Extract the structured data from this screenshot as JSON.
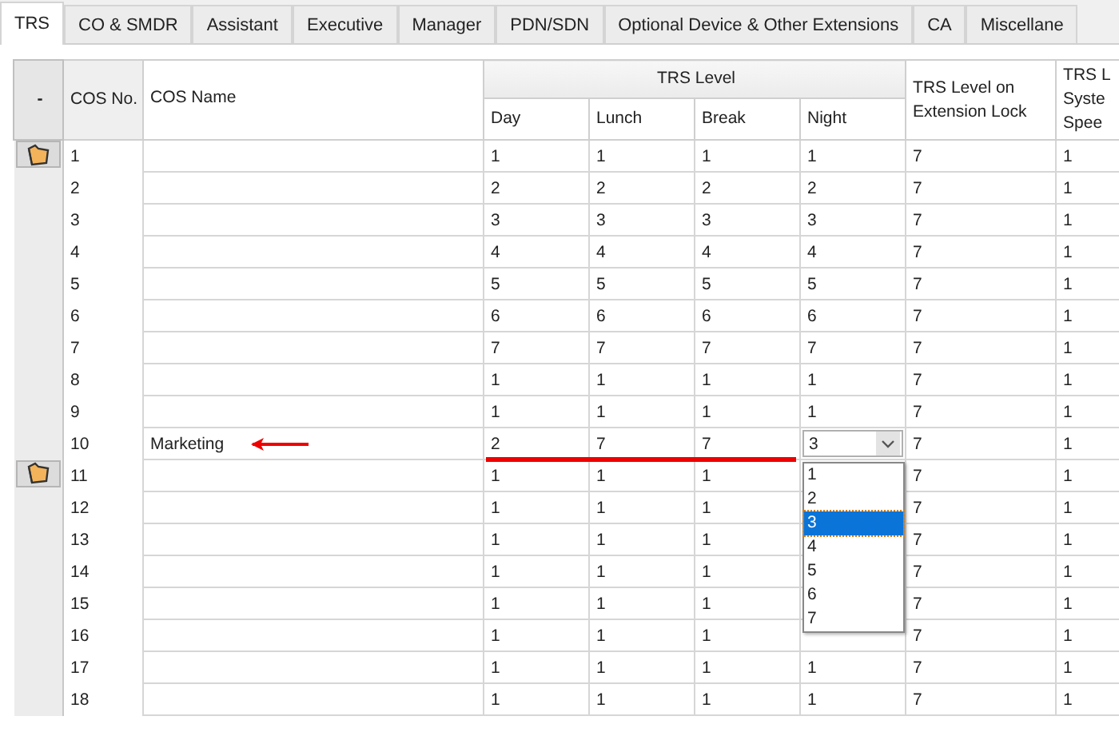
{
  "tabs": [
    {
      "label": "TRS",
      "selected": true
    },
    {
      "label": "CO & SMDR",
      "selected": false
    },
    {
      "label": "Assistant",
      "selected": false
    },
    {
      "label": "Executive",
      "selected": false
    },
    {
      "label": "Manager",
      "selected": false
    },
    {
      "label": "PDN/SDN",
      "selected": false
    },
    {
      "label": "Optional Device & Other Extensions",
      "selected": false
    },
    {
      "label": "CA",
      "selected": false
    },
    {
      "label": "Miscellane",
      "selected": false
    }
  ],
  "table": {
    "corner": "-",
    "columns": {
      "cos_no": "COS No.",
      "cos_name": "COS Name",
      "trs_level": "TRS Level",
      "day": "Day",
      "lunch": "Lunch",
      "break": "Break",
      "night": "Night",
      "ext_lock": "TRS Level on Extension Lock",
      "column_9": "TRS L Syste Spee"
    },
    "rows": [
      {
        "marked": true,
        "cos_no": "1",
        "day": "1",
        "lunch": "1",
        "break": "1",
        "night": "1",
        "ext_lock": "7",
        "column_9": "1"
      },
      {
        "marked": false,
        "cos_no": "2",
        "day": "2",
        "lunch": "2",
        "break": "2",
        "night": "2",
        "ext_lock": "7",
        "column_9": "1"
      },
      {
        "marked": false,
        "cos_no": "3",
        "day": "3",
        "lunch": "3",
        "break": "3",
        "night": "3",
        "ext_lock": "7",
        "column_9": "1"
      },
      {
        "marked": false,
        "cos_no": "4",
        "day": "4",
        "lunch": "4",
        "break": "4",
        "night": "4",
        "ext_lock": "7",
        "column_9": "1"
      },
      {
        "marked": false,
        "cos_no": "5",
        "day": "5",
        "lunch": "5",
        "break": "5",
        "night": "5",
        "ext_lock": "7",
        "column_9": "1"
      },
      {
        "marked": false,
        "cos_no": "6",
        "day": "6",
        "lunch": "6",
        "break": "6",
        "night": "6",
        "ext_lock": "7",
        "column_9": "1"
      },
      {
        "marked": false,
        "cos_no": "7",
        "day": "7",
        "lunch": "7",
        "break": "7",
        "night": "7",
        "ext_lock": "7",
        "column_9": "1"
      },
      {
        "marked": false,
        "cos_no": "8",
        "day": "1",
        "lunch": "1",
        "break": "1",
        "night": "1",
        "ext_lock": "7",
        "column_9": "1"
      },
      {
        "marked": false,
        "cos_no": "9",
        "day": "1",
        "lunch": "1",
        "break": "1",
        "night": "1",
        "ext_lock": "7",
        "column_9": "1"
      },
      {
        "marked": false,
        "cos_no": "10",
        "cos_name": "Marketing",
        "day": "2",
        "lunch": "7",
        "break": "7",
        "night_dropdown": {
          "value": "3",
          "options": [
            {
              "label": "1",
              "selected": false
            },
            {
              "label": "2",
              "selected": false
            },
            {
              "label": "3",
              "selected": true
            },
            {
              "label": "4",
              "selected": false
            },
            {
              "label": "5",
              "selected": false
            },
            {
              "label": "6",
              "selected": false
            },
            {
              "label": "7",
              "selected": false
            }
          ]
        },
        "ext_lock": "7",
        "column_9": "1"
      },
      {
        "marked": true,
        "cos_no": "11",
        "day": "1",
        "lunch": "1",
        "break": "1",
        "ext_lock": "7",
        "column_9": "1"
      },
      {
        "marked": false,
        "cos_no": "12",
        "day": "1",
        "lunch": "1",
        "break": "1",
        "ext_lock": "7",
        "column_9": "1"
      },
      {
        "marked": false,
        "cos_no": "13",
        "day": "1",
        "lunch": "1",
        "break": "1",
        "ext_lock": "7",
        "column_9": "1"
      },
      {
        "marked": false,
        "cos_no": "14",
        "day": "1",
        "lunch": "1",
        "break": "1",
        "ext_lock": "7",
        "column_9": "1"
      },
      {
        "marked": false,
        "cos_no": "15",
        "day": "1",
        "lunch": "1",
        "break": "1",
        "ext_lock": "7",
        "column_9": "1"
      },
      {
        "marked": false,
        "cos_no": "16",
        "day": "1",
        "lunch": "1",
        "break": "1",
        "ext_lock": "7",
        "column_9": "1"
      },
      {
        "marked": false,
        "cos_no": "17",
        "day": "1",
        "lunch": "1",
        "break": "1",
        "night": "1",
        "ext_lock": "7",
        "column_9": "1"
      },
      {
        "marked": false,
        "cos_no": "18",
        "day": "1",
        "lunch": "1",
        "break": "1",
        "night": "1",
        "ext_lock": "7",
        "column_9": "1"
      }
    ]
  }
}
